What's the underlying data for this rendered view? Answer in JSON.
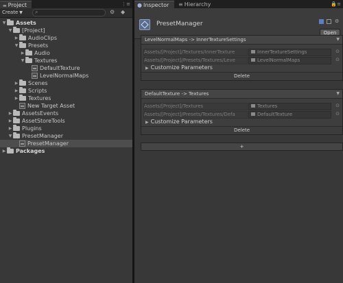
{
  "project": {
    "tabs": {
      "project": "Project",
      "hierarchy": "Hierarchy"
    },
    "toolbar": {
      "create": "Create"
    },
    "tree": [
      {
        "label": "Assets",
        "indent": 0,
        "type": "folder",
        "expanded": true,
        "bold": true
      },
      {
        "label": "[Project]",
        "indent": 1,
        "type": "folder",
        "expanded": true
      },
      {
        "label": "AudioClips",
        "indent": 2,
        "type": "folder",
        "expanded": false
      },
      {
        "label": "Presets",
        "indent": 2,
        "type": "folder",
        "expanded": true
      },
      {
        "label": "Audio",
        "indent": 3,
        "type": "folder",
        "expanded": false
      },
      {
        "label": "Textures",
        "indent": 3,
        "type": "folder",
        "expanded": true
      },
      {
        "label": "DefaultTexture",
        "indent": 4,
        "type": "asset"
      },
      {
        "label": "LevelNormalMaps",
        "indent": 4,
        "type": "asset"
      },
      {
        "label": "Scenes",
        "indent": 2,
        "type": "folder",
        "expanded": false
      },
      {
        "label": "Scripts",
        "indent": 2,
        "type": "folder",
        "expanded": false
      },
      {
        "label": "Textures",
        "indent": 2,
        "type": "folder",
        "expanded": false
      },
      {
        "label": "New Target Asset",
        "indent": 2,
        "type": "asset"
      },
      {
        "label": "AssetsEvents",
        "indent": 1,
        "type": "folder",
        "expanded": false
      },
      {
        "label": "AssetStoreTools",
        "indent": 1,
        "type": "folder",
        "expanded": false
      },
      {
        "label": "Plugins",
        "indent": 1,
        "type": "folder",
        "expanded": false
      },
      {
        "label": "PresetManager",
        "indent": 1,
        "type": "folder",
        "expanded": true
      },
      {
        "label": "PresetManager",
        "indent": 2,
        "type": "asset",
        "selected": true
      },
      {
        "label": "Packages",
        "indent": 0,
        "type": "folder",
        "expanded": false,
        "bold": true
      }
    ]
  },
  "inspector": {
    "tab": "Inspector",
    "title": "PresetManager",
    "open_button": "Open",
    "rules": [
      {
        "header": "LevelNormalMaps -> InnerTextureSettings",
        "rows": [
          {
            "path": "Assets/[Project]/Textures/InnerTexture",
            "object": "InnerTextureSettings"
          },
          {
            "path": "Assets/[Project]/Presets/Textures/Leve",
            "object": "LevelNormalMaps"
          }
        ],
        "customize": "Customize Parameters",
        "delete": "Delete"
      },
      {
        "header": "DefaultTexture -> Textures",
        "rows": [
          {
            "path": "Assets/[Project]/Textures",
            "object": "Textures"
          },
          {
            "path": "Assets/[Project]/Presets/Textures/Defa",
            "object": "DefaultTexture"
          }
        ],
        "customize": "Customize Parameters",
        "delete": "Delete"
      }
    ],
    "add_button": "+"
  },
  "colors": {
    "panel": "#383838",
    "selected_row": "#4d4d4d",
    "inspector_tab": "#3a3a3a"
  }
}
